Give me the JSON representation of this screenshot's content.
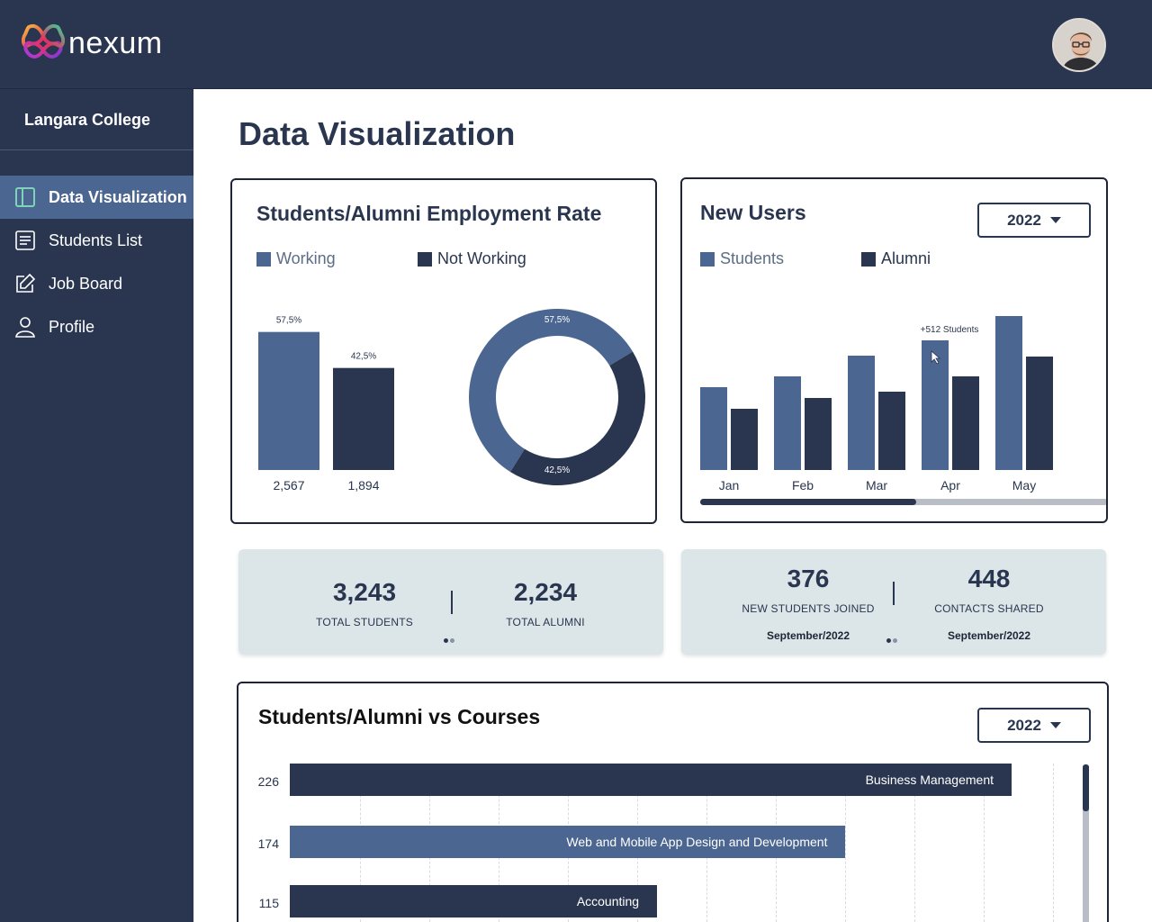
{
  "app": {
    "name": "nexum"
  },
  "sidebar": {
    "org": "Langara College",
    "items": [
      {
        "label": "Data Visualization",
        "icon": "layout-icon",
        "active": true
      },
      {
        "label": "Students List",
        "icon": "list-icon",
        "active": false
      },
      {
        "label": "Job Board",
        "icon": "edit-icon",
        "active": false
      },
      {
        "label": "Profile",
        "icon": "user-icon",
        "active": false
      }
    ]
  },
  "page": {
    "title": "Data Visualization"
  },
  "colors": {
    "primary": "#2a3650",
    "accent": "#4b6690",
    "card_bg": "#dce5e8"
  },
  "employment": {
    "title": "Students/Alumni Employment Rate",
    "legend": [
      "Working",
      "Not Working"
    ]
  },
  "new_users": {
    "title": "New Users",
    "year": "2022",
    "legend": [
      "Students",
      "Alumni"
    ],
    "tooltip": "+512 Students",
    "scroll_position": 0.53
  },
  "stats_left": {
    "a_value": "3,243",
    "a_label": "TOTAL STUDENTS",
    "b_value": "2,234",
    "b_label": "TOTAL ALUMNI"
  },
  "stats_right": {
    "a_value": "376",
    "a_label": "NEW STUDENTS JOINED",
    "a_sub": "September/2022",
    "b_value": "448",
    "b_label": "CONTACTS SHARED",
    "b_sub": "September/2022"
  },
  "courses": {
    "title": "Students/Alumni vs Courses",
    "year": "2022"
  },
  "chart_data": [
    {
      "type": "bar",
      "title": "Students/Alumni Employment Rate",
      "categories": [
        "Working",
        "Not Working"
      ],
      "values": [
        2567,
        1894
      ],
      "value_labels": [
        "2,567",
        "1,894"
      ],
      "percent_labels": [
        "57,5%",
        "42,5%"
      ],
      "percents": [
        57.5,
        42.5
      ]
    },
    {
      "type": "pie",
      "title": "Students/Alumni Employment Rate",
      "categories": [
        "Working",
        "Not Working"
      ],
      "values": [
        57.5,
        42.5
      ],
      "labels": [
        "57,5%",
        "42,5%"
      ]
    },
    {
      "type": "bar",
      "title": "New Users",
      "categories": [
        "Jan",
        "Feb",
        "Mar",
        "Apr",
        "May"
      ],
      "series": [
        {
          "name": "Students",
          "values": [
            92,
            104,
            127,
            144,
            171
          ]
        },
        {
          "name": "Alumni",
          "values": [
            68,
            80,
            87,
            104,
            126
          ]
        }
      ],
      "annotation": {
        "category": "Apr",
        "text": "+512 Students"
      },
      "ylim": [
        0,
        180
      ]
    },
    {
      "type": "bar",
      "orientation": "horizontal",
      "title": "Students/Alumni vs Courses",
      "categories": [
        "Business Management",
        "Web and Mobile App Design and Development",
        "Accounting"
      ],
      "values": [
        226,
        174,
        115
      ],
      "xlim": [
        0,
        240
      ]
    }
  ]
}
